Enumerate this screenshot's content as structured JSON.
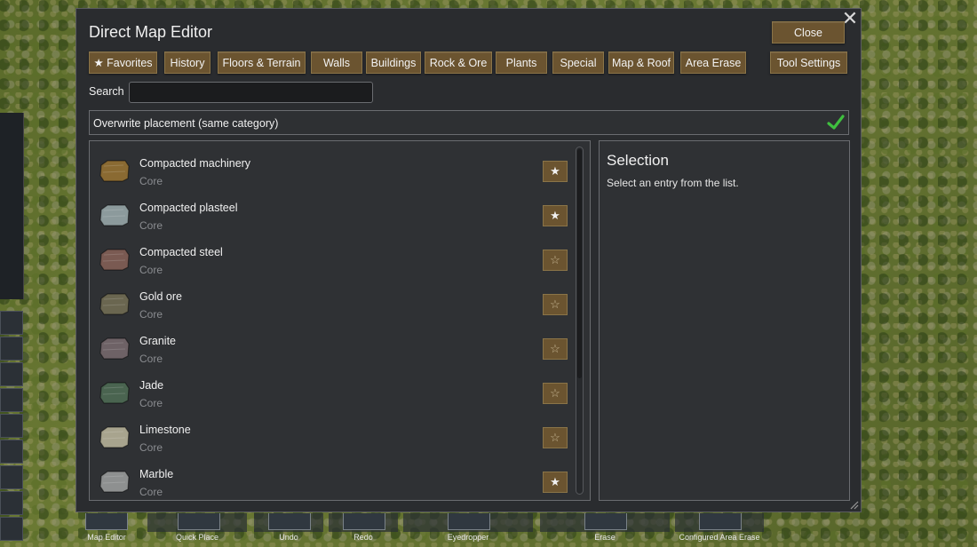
{
  "window": {
    "title": "Direct Map Editor",
    "close_label": "Close",
    "tool_settings_label": "Tool Settings"
  },
  "tabs": [
    {
      "label": "★ Favorites"
    },
    {
      "label": "History"
    },
    {
      "label": "Floors & Terrain"
    },
    {
      "label": "Walls"
    },
    {
      "label": "Buildings"
    },
    {
      "label": "Rock & Ore"
    },
    {
      "label": "Plants"
    },
    {
      "label": "Special"
    },
    {
      "label": "Map & Roof"
    },
    {
      "label": "Area Erase"
    }
  ],
  "search": {
    "label": "Search",
    "value": "",
    "placeholder": ""
  },
  "overwrite": {
    "label": "Overwrite placement (same category)",
    "checked": true
  },
  "items": [
    {
      "name": "Compacted machinery",
      "source": "Core",
      "favorite": true,
      "color": "#8a6a32"
    },
    {
      "name": "Compacted plasteel",
      "source": "Core",
      "favorite": true,
      "color": "#8c9a9c"
    },
    {
      "name": "Compacted steel",
      "source": "Core",
      "favorite": false,
      "color": "#7a5a52"
    },
    {
      "name": "Gold ore",
      "source": "Core",
      "favorite": false,
      "color": "#6a6650"
    },
    {
      "name": "Granite",
      "source": "Core",
      "favorite": false,
      "color": "#6e6266"
    },
    {
      "name": "Jade",
      "source": "Core",
      "favorite": false,
      "color": "#4a6450"
    },
    {
      "name": "Limestone",
      "source": "Core",
      "favorite": false,
      "color": "#a8a48e"
    },
    {
      "name": "Marble",
      "source": "Core",
      "favorite": true,
      "color": "#8e9090"
    }
  ],
  "star_filled": "★",
  "star_empty": "☆",
  "selection": {
    "title": "Selection",
    "hint": "Select an entry from the list."
  },
  "bottom_toolbar": [
    {
      "label": "Map Editor",
      "icon": "map-editor-icon"
    },
    {
      "label": "Quick Place",
      "icon": "quick-place-icon"
    },
    {
      "label": "Undo",
      "icon": "undo-icon"
    },
    {
      "label": "Redo",
      "icon": "redo-icon"
    },
    {
      "label": "Eyedropper",
      "icon": "eyedropper-icon"
    },
    {
      "label": "Erase",
      "icon": "erase-icon"
    },
    {
      "label": "Configured Area Erase",
      "icon": "area-erase-icon"
    }
  ],
  "colors": {
    "button_bg": "#6b5430",
    "panel_bg": "#2a2c2f",
    "check_green": "#3fbf3f"
  }
}
